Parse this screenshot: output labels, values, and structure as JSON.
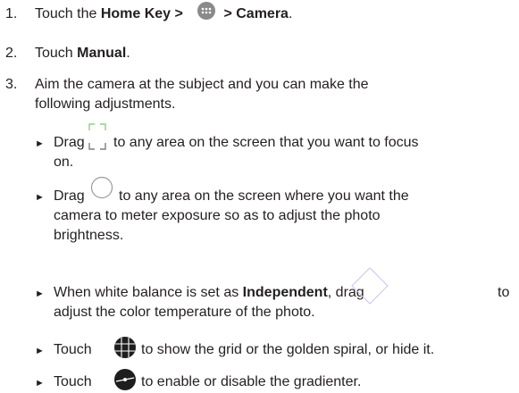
{
  "steps": [
    {
      "num": "1.",
      "a": "Touch the ",
      "b": "Home Key >",
      "c": " > Camera",
      "d": "."
    },
    {
      "num": "2.",
      "a": "Touch ",
      "b": "Manual",
      "c": "."
    },
    {
      "num": "3.",
      "line1": "Aim the camera at the subject and you can make the",
      "line2": "following adjustments."
    }
  ],
  "bullets": [
    {
      "a": "Drag",
      "b": "to any area on the screen that you want to focus",
      "c": "on.",
      "icon": "focus-frame-icon"
    },
    {
      "a": "Drag",
      "b": "to any area on the screen where you want the",
      "c": "camera to meter exposure so as to adjust the photo",
      "d": "brightness.",
      "icon": "exposure-circle-icon"
    },
    {
      "a": "When white balance is set as ",
      "bold": "Independent",
      "b": ", drag",
      "c": "to",
      "d": "adjust the color temperature of the photo.",
      "icon": "white-balance-diamond-icon"
    },
    {
      "a": "Touch",
      "b": "to show the grid or the golden spiral, or hide it.",
      "icon": "grid-icon"
    },
    {
      "a": "Touch",
      "b": "to enable or disable the gradienter.",
      "icon": "gradienter-icon"
    }
  ],
  "bullet_glyph": "►",
  "colors": {
    "text": "#231f20",
    "icon_dark": "#231f20",
    "icon_light": "#8ad27a",
    "diamond": "#c9c4ef"
  }
}
